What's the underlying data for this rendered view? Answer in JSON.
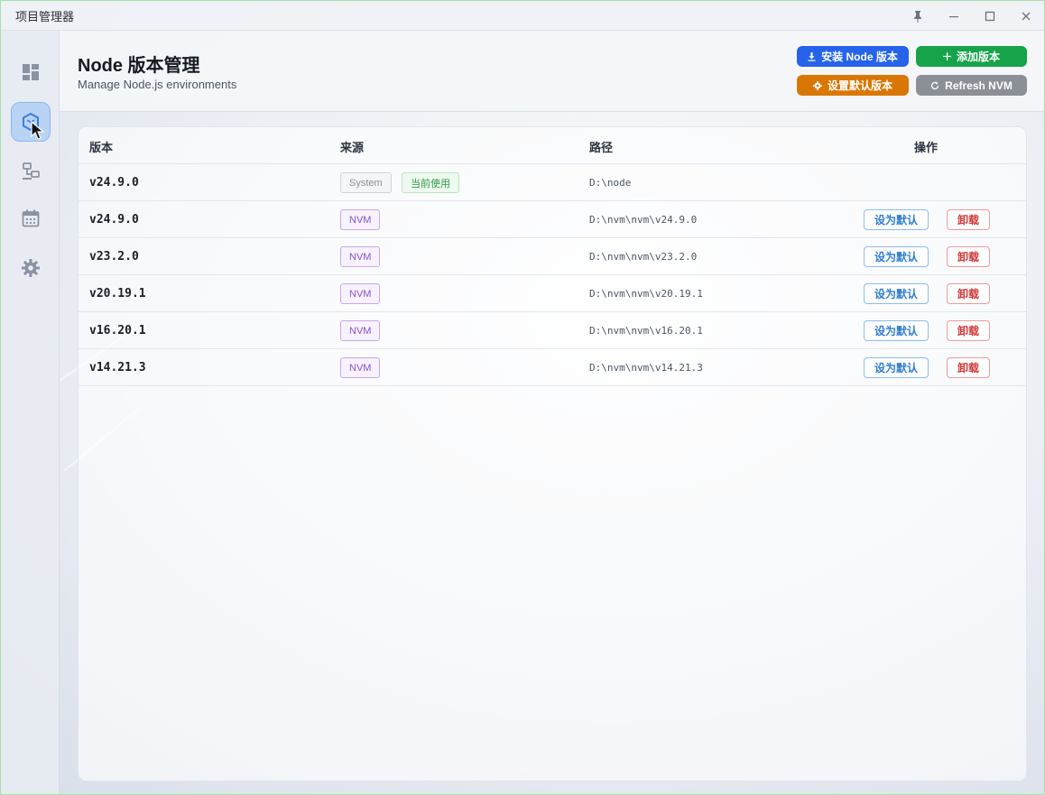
{
  "window": {
    "title": "项目管理器"
  },
  "header": {
    "title": "Node 版本管理",
    "subtitle": "Manage Node.js environments",
    "buttons": {
      "install": "安装 Node 版本",
      "add": "添加版本",
      "set_default": "设置默认版本",
      "refresh": "Refresh NVM"
    }
  },
  "sidebar": {
    "items": [
      {
        "icon": "dashboard-icon"
      },
      {
        "icon": "node-package-icon",
        "active": true
      },
      {
        "icon": "network-icon"
      },
      {
        "icon": "calendar-icon"
      },
      {
        "icon": "gear-icon"
      }
    ]
  },
  "table": {
    "headers": {
      "version": "版本",
      "source": "来源",
      "path": "路径",
      "actions": "操作"
    },
    "system_row": {
      "version": "v24.9.0",
      "source_tag": "System",
      "current_tag": "当前使用",
      "path": "D:\\node"
    },
    "rows": [
      {
        "version": "v24.9.0",
        "source": "NVM",
        "path": "D:\\nvm\\nvm\\v24.9.0"
      },
      {
        "version": "v23.2.0",
        "source": "NVM",
        "path": "D:\\nvm\\nvm\\v23.2.0"
      },
      {
        "version": "v20.19.1",
        "source": "NVM",
        "path": "D:\\nvm\\nvm\\v20.19.1"
      },
      {
        "version": "v16.20.1",
        "source": "NVM",
        "path": "D:\\nvm\\nvm\\v16.20.1"
      },
      {
        "version": "v14.21.3",
        "source": "NVM",
        "path": "D:\\nvm\\nvm\\v14.21.3"
      }
    ],
    "row_actions": {
      "set_default": "设为默认",
      "uninstall": "卸载"
    }
  },
  "colors": {
    "install": "#2563eb",
    "add": "#16a34a",
    "set_default": "#d97706",
    "refresh": "#8b8f96",
    "nvm_tag": "#8a4fd6",
    "current_tag": "#2e9a45",
    "uninstall": "#d03a3a"
  }
}
